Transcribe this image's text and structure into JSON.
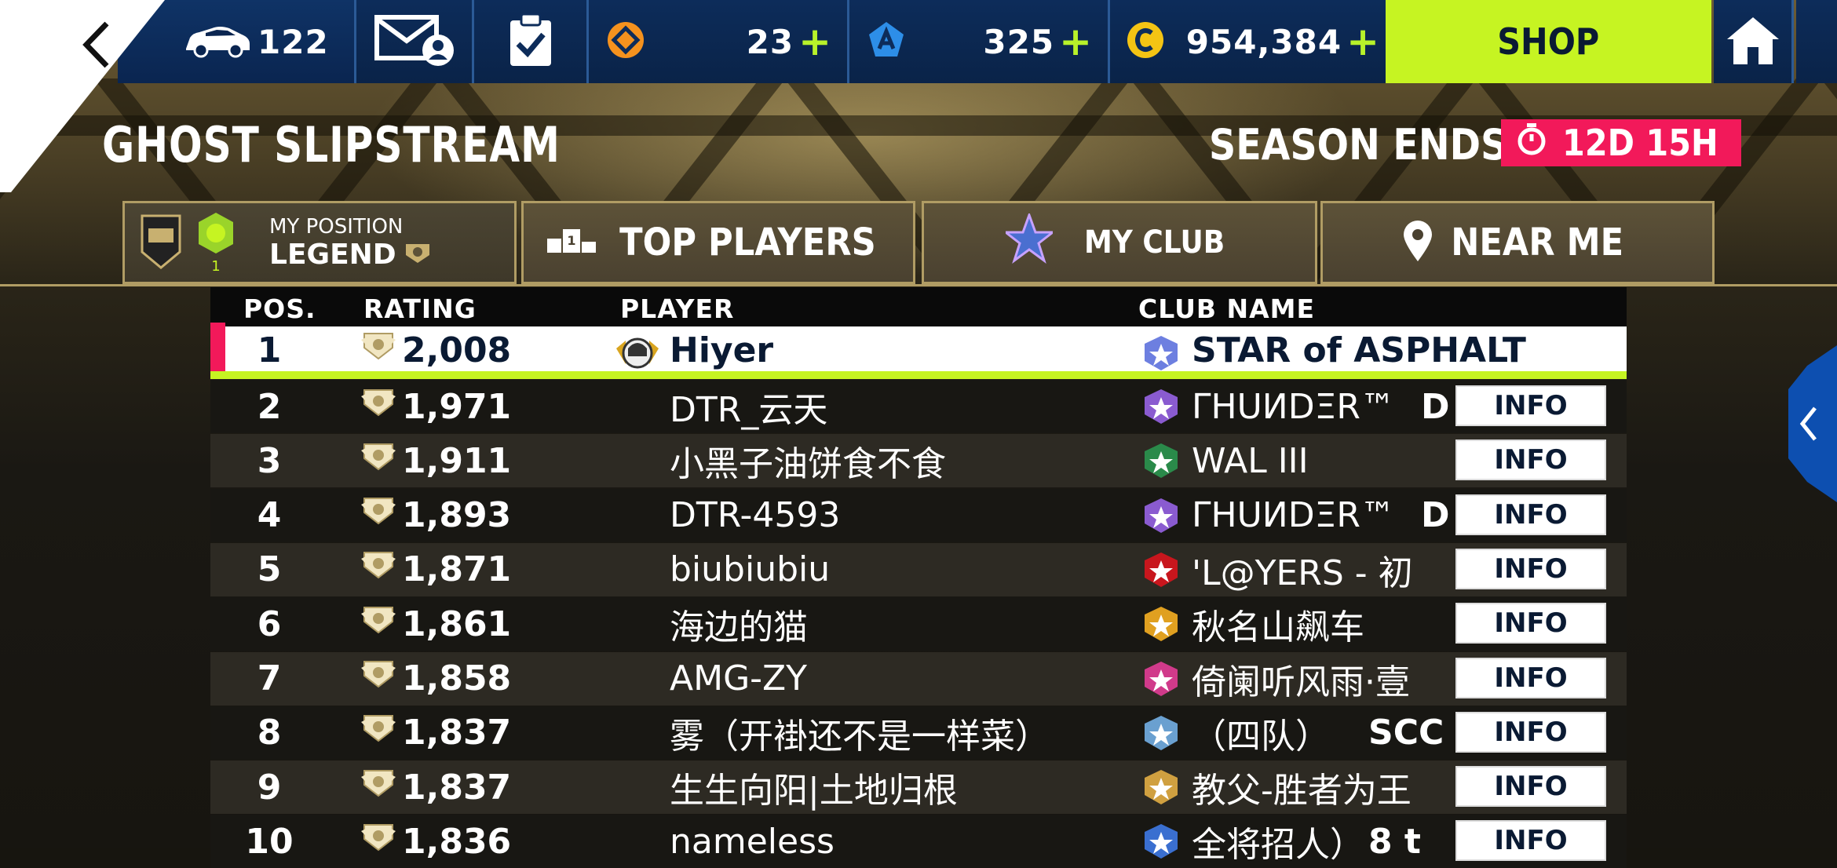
{
  "topbar": {
    "cars": "122",
    "tickets": "23",
    "tokens": "325",
    "credits": "954,384",
    "plus": "+",
    "shop_label": "SHOP",
    "colors": {
      "plus": "#b8f22a",
      "shop_bg": "#c6f422",
      "bar_bg": "#0d2c5a"
    }
  },
  "title": "GHOST SLIPSTREAM",
  "season": {
    "label": "SEASON ENDS IN",
    "timer": "12D 15H",
    "timer_color": "#f2195a"
  },
  "tabs": {
    "my_position_caption": "MY POSITION",
    "my_position_league": "LEGEND",
    "my_position_rank": "1",
    "top_players": "TOP PLAYERS",
    "top_players_badge": "1",
    "my_club": "MY CLUB",
    "near_me": "NEAR ME"
  },
  "table": {
    "headers": {
      "pos": "POS.",
      "rating": "RATING",
      "player": "PLAYER",
      "club": "CLUB NAME"
    },
    "info_label": "INFO",
    "rows": [
      {
        "pos": "1",
        "rating": "2,008",
        "player": "Hiyer",
        "club": "STAR of ASPHALT",
        "tag": ""
      },
      {
        "pos": "2",
        "rating": "1,971",
        "player": "DTR_云天",
        "club": "ΓHUИDΞR™",
        "tag": "D"
      },
      {
        "pos": "3",
        "rating": "1,911",
        "player": "小黑子油饼食不食",
        "club": "WAL III",
        "tag": ""
      },
      {
        "pos": "4",
        "rating": "1,893",
        "player": "DTR-4593",
        "club": "ΓHUИDΞR™",
        "tag": "D"
      },
      {
        "pos": "5",
        "rating": "1,871",
        "player": "biubiubiu",
        "club": "'L@YERS - 初",
        "tag": ""
      },
      {
        "pos": "6",
        "rating": "1,861",
        "player": "海边的猫",
        "club": "秋名山飙车",
        "tag": ""
      },
      {
        "pos": "7",
        "rating": "1,858",
        "player": "AMG-ZY",
        "club": "倚阑听风雨·壹",
        "tag": ""
      },
      {
        "pos": "8",
        "rating": "1,837",
        "player": "雾（开褂还不是一样菜）",
        "club": "（四队）",
        "tag": "SCC"
      },
      {
        "pos": "9",
        "rating": "1,837",
        "player": "生生向阳|土地归根",
        "club": "教父-胜者为王",
        "tag": ""
      },
      {
        "pos": "10",
        "rating": "1,836",
        "player": "nameless",
        "club": "全将招人）",
        "tag": "8 t"
      }
    ]
  },
  "colors": {
    "highlight_row": "#ffffff",
    "highlight_underline": "#c6f422",
    "highlight_marker": "#f2195a",
    "tab_border": "#b09c64"
  }
}
